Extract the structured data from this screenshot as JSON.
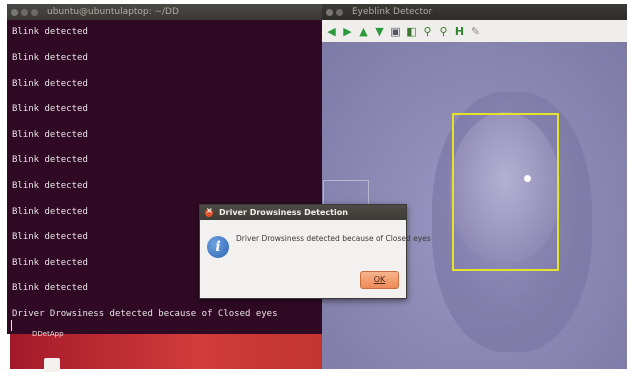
{
  "terminal": {
    "title": "ubuntu@ubuntulaptop: ~/DD",
    "lines": [
      "Blink detected",
      "Blink detected",
      "Blink detected",
      "Blink detected",
      "Blink detected",
      "Blink detected",
      "Blink detected",
      "Blink detected",
      "Blink detected",
      "Blink detected",
      "Blink detected",
      "Driver Drowsiness detected because of Closed eyes"
    ]
  },
  "desktop": {
    "label": "DDetApp"
  },
  "camera_window": {
    "title": "Eyeblink Detector",
    "toolbar_icons": [
      "arrow-left-icon",
      "arrow-right-icon",
      "arrow-up-icon",
      "arrow-down-icon",
      "save-icon",
      "fit-icon",
      "zoom-in-icon",
      "zoom-out-icon",
      "properties-icon",
      "pen-icon"
    ],
    "box_color": "#e6e22c"
  },
  "dialog": {
    "title": "Driver Drowsiness Detection",
    "message": "Driver Drowsiness detected because of Closed eyes",
    "ok_label": "OK"
  }
}
